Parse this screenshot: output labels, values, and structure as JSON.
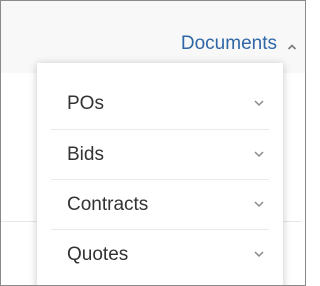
{
  "nav": {
    "label": "Documents",
    "caret_icon": "chevron-up-icon",
    "accent_color": "#2f67a6"
  },
  "dropdown": {
    "items": [
      {
        "label": "POs",
        "icon": "chevron-down-icon"
      },
      {
        "label": "Bids",
        "icon": "chevron-down-icon"
      },
      {
        "label": "Contracts",
        "icon": "chevron-down-icon"
      },
      {
        "label": "Quotes",
        "icon": "chevron-down-icon"
      }
    ]
  }
}
